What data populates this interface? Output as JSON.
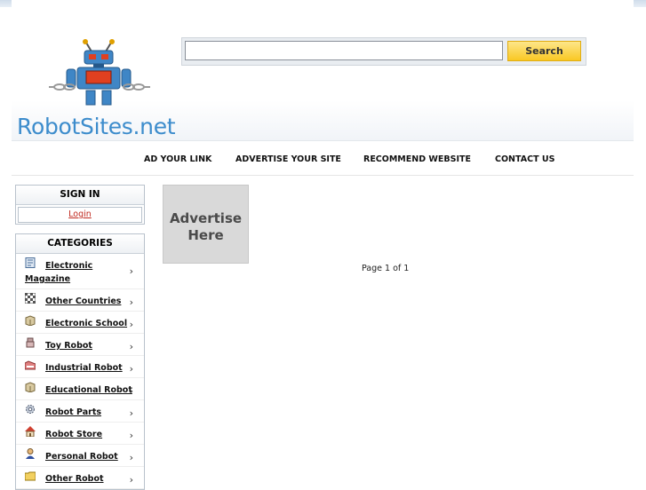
{
  "site": {
    "logo_text": "RobotSites.net"
  },
  "search": {
    "value": "",
    "placeholder": "",
    "button_label": "Search"
  },
  "nav": {
    "items": [
      {
        "label": "AD YOUR LINK"
      },
      {
        "label": "ADVERTISE YOUR SITE"
      },
      {
        "label": "RECOMMEND WEBSITE"
      },
      {
        "label": "CONTACT US"
      }
    ]
  },
  "signin": {
    "title": "SIGN IN",
    "login_label": "Login"
  },
  "categories": {
    "title": "CATEGORIES",
    "items": [
      {
        "label": "Electronic Magazine",
        "icon": "magazine-icon"
      },
      {
        "label": "Other Countries",
        "icon": "checkered-flag-icon"
      },
      {
        "label": "Electronic School",
        "icon": "box-icon"
      },
      {
        "label": "Toy Robot",
        "icon": "toy-icon"
      },
      {
        "label": "Industrial Robot",
        "icon": "factory-icon"
      },
      {
        "label": "Educational Robot",
        "icon": "box-icon"
      },
      {
        "label": "Robot Parts",
        "icon": "gear-icon"
      },
      {
        "label": "Robot Store",
        "icon": "house-icon"
      },
      {
        "label": "Personal Robot",
        "icon": "person-icon"
      },
      {
        "label": "Other Robot",
        "icon": "folder-icon"
      }
    ]
  },
  "ad": {
    "line1": "Advertise",
    "line2": "Here"
  },
  "pager": {
    "text": "Page 1 of 1"
  },
  "colors": {
    "logo_blue": "#3c8ccc",
    "button_yellow": "#f9c824",
    "login_red": "#c0281e"
  }
}
